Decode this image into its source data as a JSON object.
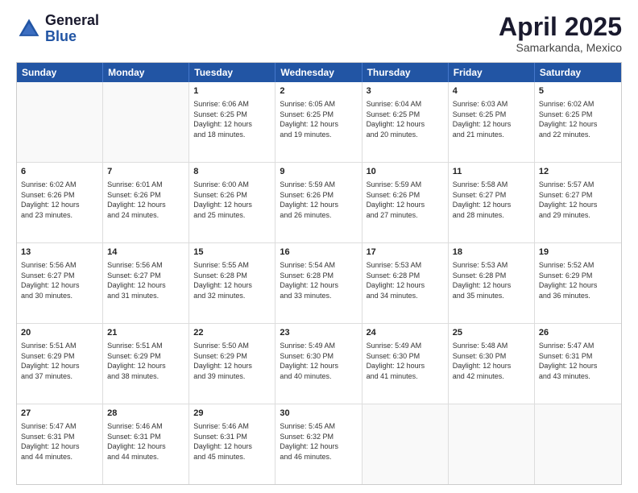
{
  "header": {
    "logo_general": "General",
    "logo_blue": "Blue",
    "month_title": "April 2025",
    "subtitle": "Samarkanda, Mexico"
  },
  "days_of_week": [
    "Sunday",
    "Monday",
    "Tuesday",
    "Wednesday",
    "Thursday",
    "Friday",
    "Saturday"
  ],
  "weeks": [
    [
      {
        "day": "",
        "empty": true
      },
      {
        "day": "",
        "empty": true
      },
      {
        "day": "1",
        "lines": [
          "Sunrise: 6:06 AM",
          "Sunset: 6:25 PM",
          "Daylight: 12 hours",
          "and 18 minutes."
        ]
      },
      {
        "day": "2",
        "lines": [
          "Sunrise: 6:05 AM",
          "Sunset: 6:25 PM",
          "Daylight: 12 hours",
          "and 19 minutes."
        ]
      },
      {
        "day": "3",
        "lines": [
          "Sunrise: 6:04 AM",
          "Sunset: 6:25 PM",
          "Daylight: 12 hours",
          "and 20 minutes."
        ]
      },
      {
        "day": "4",
        "lines": [
          "Sunrise: 6:03 AM",
          "Sunset: 6:25 PM",
          "Daylight: 12 hours",
          "and 21 minutes."
        ]
      },
      {
        "day": "5",
        "lines": [
          "Sunrise: 6:02 AM",
          "Sunset: 6:25 PM",
          "Daylight: 12 hours",
          "and 22 minutes."
        ]
      }
    ],
    [
      {
        "day": "6",
        "lines": [
          "Sunrise: 6:02 AM",
          "Sunset: 6:26 PM",
          "Daylight: 12 hours",
          "and 23 minutes."
        ]
      },
      {
        "day": "7",
        "lines": [
          "Sunrise: 6:01 AM",
          "Sunset: 6:26 PM",
          "Daylight: 12 hours",
          "and 24 minutes."
        ]
      },
      {
        "day": "8",
        "lines": [
          "Sunrise: 6:00 AM",
          "Sunset: 6:26 PM",
          "Daylight: 12 hours",
          "and 25 minutes."
        ]
      },
      {
        "day": "9",
        "lines": [
          "Sunrise: 5:59 AM",
          "Sunset: 6:26 PM",
          "Daylight: 12 hours",
          "and 26 minutes."
        ]
      },
      {
        "day": "10",
        "lines": [
          "Sunrise: 5:59 AM",
          "Sunset: 6:26 PM",
          "Daylight: 12 hours",
          "and 27 minutes."
        ]
      },
      {
        "day": "11",
        "lines": [
          "Sunrise: 5:58 AM",
          "Sunset: 6:27 PM",
          "Daylight: 12 hours",
          "and 28 minutes."
        ]
      },
      {
        "day": "12",
        "lines": [
          "Sunrise: 5:57 AM",
          "Sunset: 6:27 PM",
          "Daylight: 12 hours",
          "and 29 minutes."
        ]
      }
    ],
    [
      {
        "day": "13",
        "lines": [
          "Sunrise: 5:56 AM",
          "Sunset: 6:27 PM",
          "Daylight: 12 hours",
          "and 30 minutes."
        ]
      },
      {
        "day": "14",
        "lines": [
          "Sunrise: 5:56 AM",
          "Sunset: 6:27 PM",
          "Daylight: 12 hours",
          "and 31 minutes."
        ]
      },
      {
        "day": "15",
        "lines": [
          "Sunrise: 5:55 AM",
          "Sunset: 6:28 PM",
          "Daylight: 12 hours",
          "and 32 minutes."
        ]
      },
      {
        "day": "16",
        "lines": [
          "Sunrise: 5:54 AM",
          "Sunset: 6:28 PM",
          "Daylight: 12 hours",
          "and 33 minutes."
        ]
      },
      {
        "day": "17",
        "lines": [
          "Sunrise: 5:53 AM",
          "Sunset: 6:28 PM",
          "Daylight: 12 hours",
          "and 34 minutes."
        ]
      },
      {
        "day": "18",
        "lines": [
          "Sunrise: 5:53 AM",
          "Sunset: 6:28 PM",
          "Daylight: 12 hours",
          "and 35 minutes."
        ]
      },
      {
        "day": "19",
        "lines": [
          "Sunrise: 5:52 AM",
          "Sunset: 6:29 PM",
          "Daylight: 12 hours",
          "and 36 minutes."
        ]
      }
    ],
    [
      {
        "day": "20",
        "lines": [
          "Sunrise: 5:51 AM",
          "Sunset: 6:29 PM",
          "Daylight: 12 hours",
          "and 37 minutes."
        ]
      },
      {
        "day": "21",
        "lines": [
          "Sunrise: 5:51 AM",
          "Sunset: 6:29 PM",
          "Daylight: 12 hours",
          "and 38 minutes."
        ]
      },
      {
        "day": "22",
        "lines": [
          "Sunrise: 5:50 AM",
          "Sunset: 6:29 PM",
          "Daylight: 12 hours",
          "and 39 minutes."
        ]
      },
      {
        "day": "23",
        "lines": [
          "Sunrise: 5:49 AM",
          "Sunset: 6:30 PM",
          "Daylight: 12 hours",
          "and 40 minutes."
        ]
      },
      {
        "day": "24",
        "lines": [
          "Sunrise: 5:49 AM",
          "Sunset: 6:30 PM",
          "Daylight: 12 hours",
          "and 41 minutes."
        ]
      },
      {
        "day": "25",
        "lines": [
          "Sunrise: 5:48 AM",
          "Sunset: 6:30 PM",
          "Daylight: 12 hours",
          "and 42 minutes."
        ]
      },
      {
        "day": "26",
        "lines": [
          "Sunrise: 5:47 AM",
          "Sunset: 6:31 PM",
          "Daylight: 12 hours",
          "and 43 minutes."
        ]
      }
    ],
    [
      {
        "day": "27",
        "lines": [
          "Sunrise: 5:47 AM",
          "Sunset: 6:31 PM",
          "Daylight: 12 hours",
          "and 44 minutes."
        ]
      },
      {
        "day": "28",
        "lines": [
          "Sunrise: 5:46 AM",
          "Sunset: 6:31 PM",
          "Daylight: 12 hours",
          "and 44 minutes."
        ]
      },
      {
        "day": "29",
        "lines": [
          "Sunrise: 5:46 AM",
          "Sunset: 6:31 PM",
          "Daylight: 12 hours",
          "and 45 minutes."
        ]
      },
      {
        "day": "30",
        "lines": [
          "Sunrise: 5:45 AM",
          "Sunset: 6:32 PM",
          "Daylight: 12 hours",
          "and 46 minutes."
        ]
      },
      {
        "day": "",
        "empty": true
      },
      {
        "day": "",
        "empty": true
      },
      {
        "day": "",
        "empty": true
      }
    ]
  ]
}
